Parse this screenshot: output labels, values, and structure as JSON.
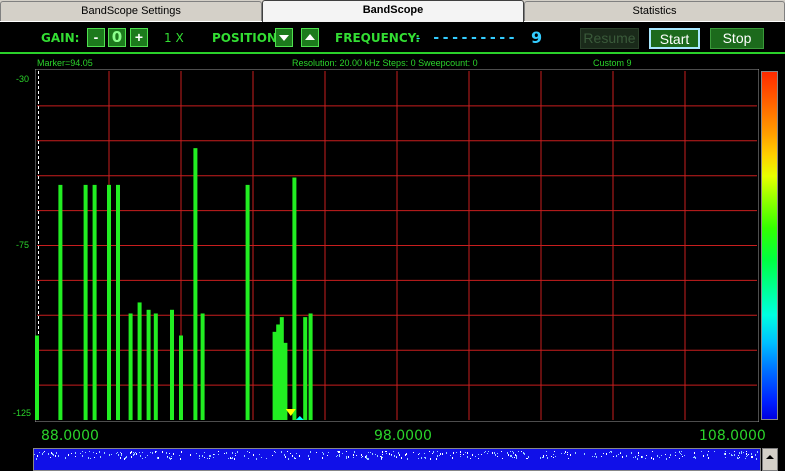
{
  "tabs": [
    {
      "label": "BandScope Settings",
      "active": false
    },
    {
      "label": "BandScope",
      "active": true
    },
    {
      "label": "Statistics",
      "active": false
    }
  ],
  "toolbar": {
    "gain_label": "GAIN:",
    "gain_minus": "-",
    "gain_value": "0",
    "gain_plus": "+",
    "multiplier": "1 X",
    "position_label": "POSITION:",
    "frequency_label": "FREQUENCY:",
    "frequency_sep": "-",
    "frequency_dashes": "---------",
    "frequency_digit": "9",
    "resume_label": "Resume",
    "start_label": "Start",
    "stop_label": "Stop"
  },
  "info": {
    "marker": "Marker=94.05",
    "resolution": "Resolution: 20.00 kHz  Steps: 0  Sweepcount: 0",
    "custom": "Custom 9"
  },
  "colors": {
    "signal": "#22ee22",
    "grid": "#c81e1e",
    "text": "#2bd42b",
    "marker_yellow": "#ffff00",
    "marker_cyan": "#00ffff"
  },
  "chart_data": {
    "type": "bar",
    "xlim": [
      88.0,
      108.0
    ],
    "ylim": [
      -125,
      -30
    ],
    "x_ticks": [
      "88.0000",
      "98.0000",
      "108.0000"
    ],
    "y_ticks": [
      "-30",
      "-75",
      "-125"
    ],
    "grid": true,
    "bars": [
      {
        "x": 88.0,
        "y": -102
      },
      {
        "x": 88.65,
        "y": -61
      },
      {
        "x": 89.35,
        "y": -61
      },
      {
        "x": 89.6,
        "y": -61
      },
      {
        "x": 90.0,
        "y": -61
      },
      {
        "x": 90.25,
        "y": -61
      },
      {
        "x": 90.6,
        "y": -96
      },
      {
        "x": 90.85,
        "y": -93
      },
      {
        "x": 91.1,
        "y": -95
      },
      {
        "x": 91.3,
        "y": -96
      },
      {
        "x": 91.75,
        "y": -95
      },
      {
        "x": 92.0,
        "y": -102
      },
      {
        "x": 92.4,
        "y": -51
      },
      {
        "x": 92.6,
        "y": -96
      },
      {
        "x": 93.85,
        "y": -61
      },
      {
        "x": 94.6,
        "y": -101
      },
      {
        "x": 94.7,
        "y": -99
      },
      {
        "x": 94.8,
        "y": -97
      },
      {
        "x": 94.9,
        "y": -104
      },
      {
        "x": 95.15,
        "y": -59
      },
      {
        "x": 95.45,
        "y": -97
      },
      {
        "x": 95.6,
        "y": -96
      }
    ],
    "marker_x": 94.05
  }
}
